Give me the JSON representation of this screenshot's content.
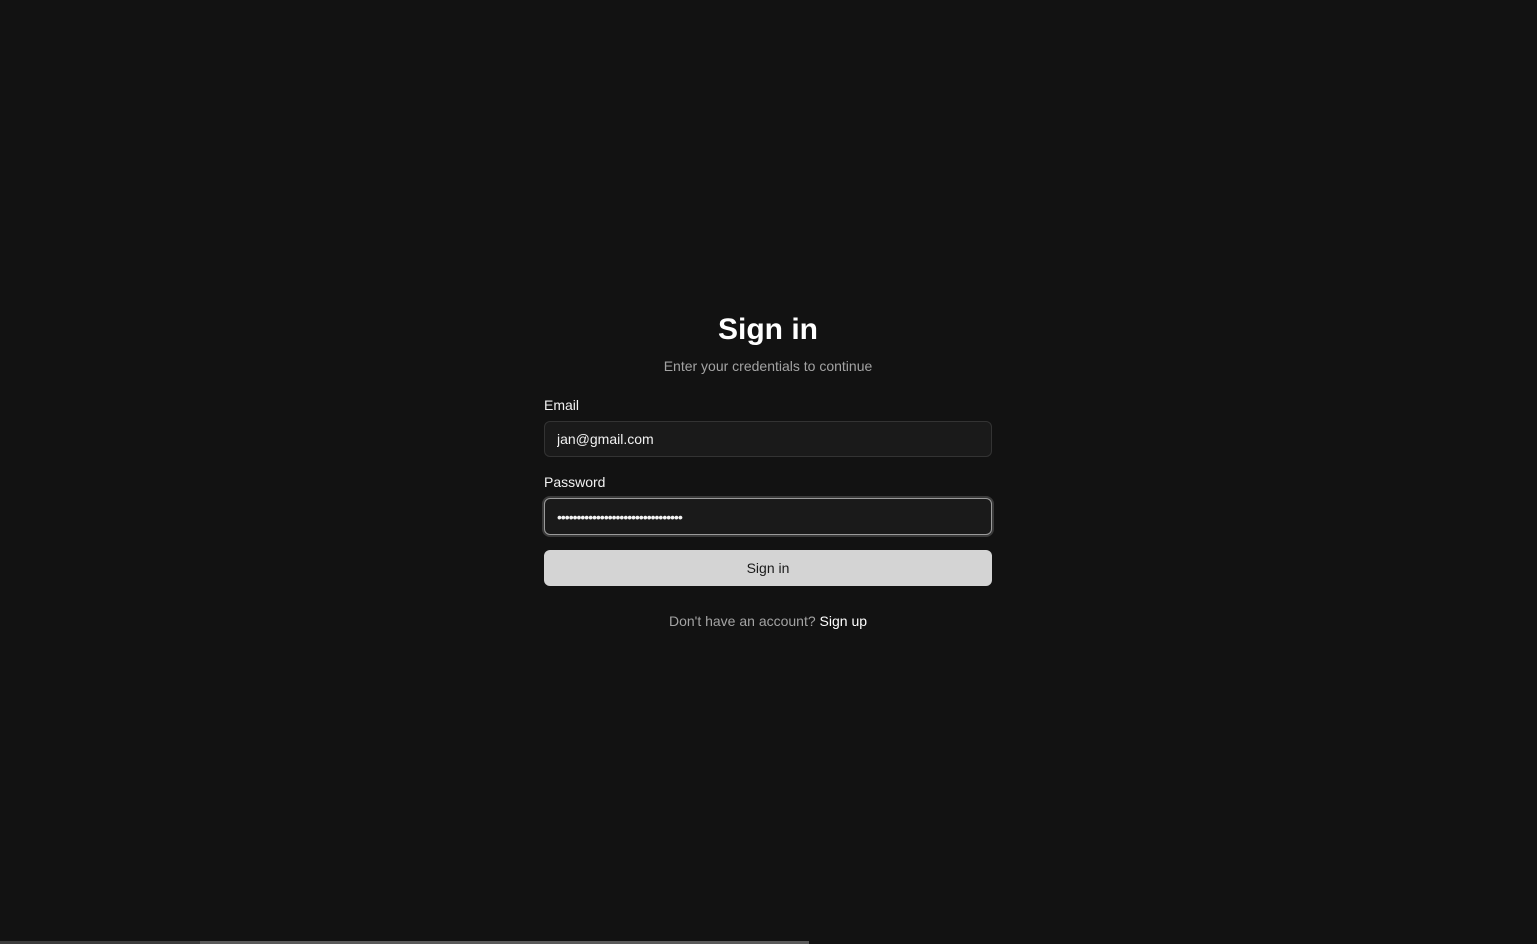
{
  "header": {
    "title": "Sign in",
    "subtitle": "Enter your credentials to continue"
  },
  "form": {
    "email": {
      "label": "Email",
      "value": "jan@gmail.com"
    },
    "password": {
      "label": "Password",
      "value": "••••••••••••••••••••••••••••••••"
    },
    "submit_label": "Sign in"
  },
  "footer": {
    "prompt": "Don't have an account?",
    "link_label": "Sign up"
  },
  "colors": {
    "background": "#121212",
    "input_background": "#1a1a1a",
    "button_background": "#d4d4d4",
    "muted_text": "#a3a3a3"
  }
}
